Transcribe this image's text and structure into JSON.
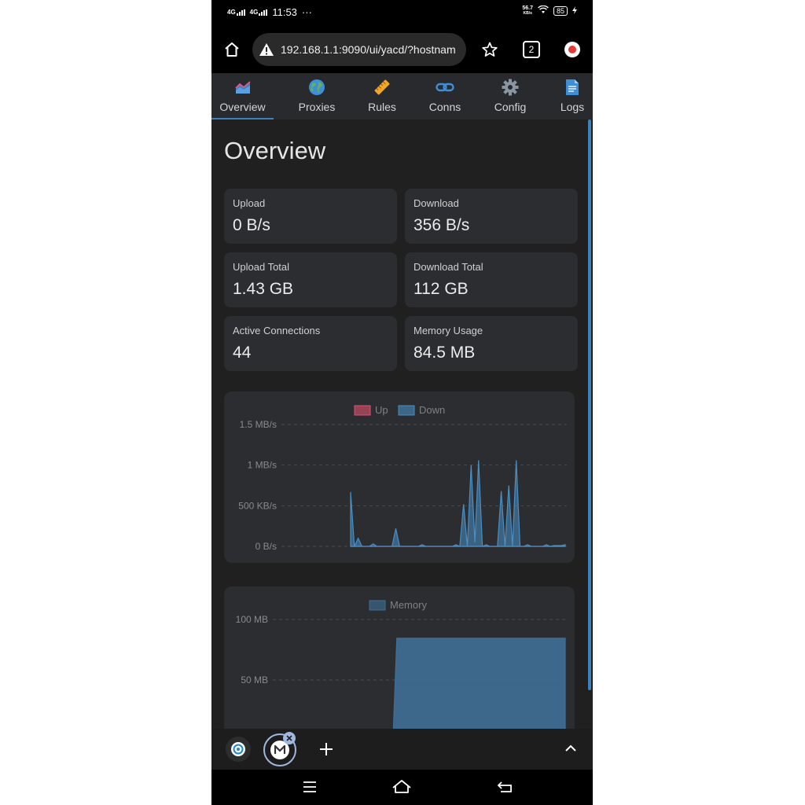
{
  "status_bar": {
    "time": "11:53",
    "dots": "···",
    "signal1": "4G",
    "signal2": "4G",
    "net_speed_value": "56.7",
    "net_speed_unit": "KB/s",
    "battery": "85"
  },
  "browser": {
    "url": "192.168.1.1:9090/ui/yacd/?hostnam",
    "tab_count": "2",
    "icons": [
      "home-icon",
      "warning-icon",
      "star-icon",
      "tabs-icon",
      "profile-icon"
    ]
  },
  "nav": {
    "tabs": [
      {
        "label": "Overview",
        "icon": "overview-chart-icon",
        "active": true
      },
      {
        "label": "Proxies",
        "icon": "globe-icon",
        "active": false
      },
      {
        "label": "Rules",
        "icon": "ruler-icon",
        "active": false
      },
      {
        "label": "Conns",
        "icon": "link-icon",
        "active": false
      },
      {
        "label": "Config",
        "icon": "gear-icon",
        "active": false
      },
      {
        "label": "Logs",
        "icon": "document-icon",
        "active": false
      }
    ]
  },
  "overview": {
    "title": "Overview",
    "cards": [
      {
        "label": "Upload",
        "value": "0 B/s"
      },
      {
        "label": "Download",
        "value": "356 B/s"
      },
      {
        "label": "Upload Total",
        "value": "1.43 GB"
      },
      {
        "label": "Download Total",
        "value": "112 GB"
      },
      {
        "label": "Active Connections",
        "value": "44"
      },
      {
        "label": "Memory Usage",
        "value": "84.5 MB"
      }
    ]
  },
  "colors": {
    "accent": "#3d82bf",
    "up": "#e0516f",
    "down": "#4a8ec2",
    "memory": "#3f6f96"
  },
  "chart_data": [
    {
      "type": "area",
      "legend": [
        "Up",
        "Down"
      ],
      "legend_position": "top-center",
      "y_ticks": [
        "0 B/s",
        "500 KB/s",
        "1 MB/s",
        "1.5 MB/s"
      ],
      "ylim": [
        0,
        1.5
      ],
      "y_unit": "MB/s",
      "grid": true,
      "series": [
        {
          "name": "Down",
          "values": [
            0.67,
            0,
            0.1,
            0,
            0,
            0,
            0.03,
            0,
            0,
            0,
            0,
            0,
            0.22,
            0,
            0,
            0,
            0,
            0,
            0,
            0.02,
            0,
            0,
            0,
            0,
            0,
            0,
            0,
            0,
            0.02,
            0,
            0.52,
            0,
            1.0,
            0.05,
            1.06,
            0,
            0.02,
            0,
            0,
            0,
            0.68,
            0,
            0.75,
            0,
            1.06,
            0,
            0,
            0.02,
            0,
            0,
            0,
            0,
            0.02,
            0,
            0.01,
            0.01,
            0.01,
            0.02
          ]
        },
        {
          "name": "Up",
          "values": [
            0,
            0,
            0,
            0,
            0,
            0,
            0,
            0,
            0,
            0,
            0,
            0,
            0,
            0,
            0,
            0,
            0,
            0,
            0,
            0,
            0,
            0,
            0,
            0,
            0,
            0,
            0,
            0,
            0,
            0,
            0,
            0,
            0,
            0,
            0,
            0,
            0,
            0,
            0,
            0,
            0,
            0,
            0,
            0,
            0,
            0,
            0,
            0,
            0,
            0,
            0,
            0,
            0,
            0,
            0,
            0,
            0,
            0
          ]
        }
      ]
    },
    {
      "type": "area",
      "legend": [
        "Memory"
      ],
      "legend_position": "top-center",
      "y_ticks": [
        "50 MB",
        "100 MB"
      ],
      "ylim": [
        0,
        100
      ],
      "y_unit": "MB",
      "grid": true,
      "series": [
        {
          "name": "Memory",
          "values": [
            0,
            0,
            0,
            0,
            0,
            0,
            0,
            0,
            0,
            0,
            0,
            0,
            0,
            0,
            84.5,
            84.5,
            84.5,
            84.5,
            84.5,
            84.5,
            84.5,
            84.5,
            84.5,
            84.5,
            84.5,
            84.5,
            84.5,
            84.5,
            84.5,
            84.5,
            84.5,
            84.5,
            84.5,
            84.5,
            84.5,
            84.5,
            84.5,
            84.5,
            84.5,
            84.5,
            84.5,
            84.5,
            84.5,
            84.5,
            84.5,
            84.5,
            84.5,
            84.5,
            84.5,
            84.5,
            84.5,
            84.5,
            84.5,
            84.5,
            84.5,
            84.5,
            84.5,
            84.5
          ]
        }
      ]
    }
  ]
}
